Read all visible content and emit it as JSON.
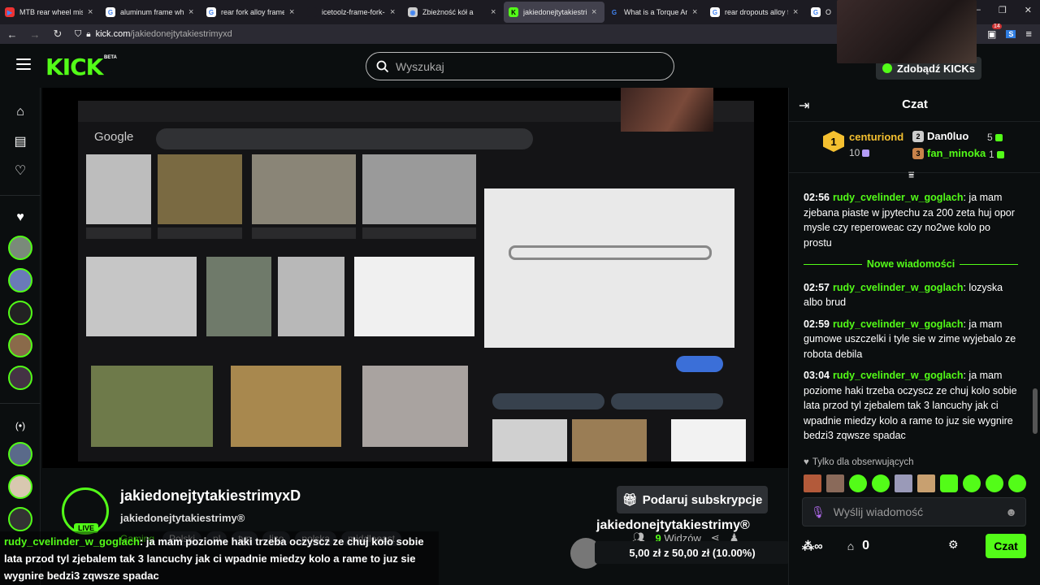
{
  "browser": {
    "tabs": [
      {
        "title": "MTB rear wheel mis",
        "fav_color": "#e33",
        "fav_glyph": "▶"
      },
      {
        "title": "aluminum frame wh",
        "fav_color": "#fff",
        "fav_glyph": "G"
      },
      {
        "title": "rear fork alloy frame",
        "fav_color": "#fff",
        "fav_glyph": "G"
      },
      {
        "title": "icetoolz-frame-fork-end",
        "fav_color": "#1c1b22",
        "fav_glyph": ""
      },
      {
        "title": "Zbieżność kół a",
        "fav_color": "#ccc",
        "fav_glyph": "◉"
      },
      {
        "title": "jakiedonejtytakiestri",
        "fav_color": "#53fc18",
        "fav_glyph": "K"
      },
      {
        "title": "What is a Torque Ar",
        "fav_color": "#1c1b22",
        "fav_glyph": "G"
      },
      {
        "title": "rear dropouts alloy f",
        "fav_color": "#fff",
        "fav_glyph": "G"
      },
      {
        "title": "O",
        "fav_color": "#fff",
        "fav_glyph": "G"
      }
    ],
    "url_domain": "kick.com",
    "url_path": "/jakiedonejtytakiestrimyxd",
    "ext_count": "14"
  },
  "header": {
    "logo": "KICK",
    "beta": "BETA",
    "search_placeholder": "Wyszukaj",
    "get_kicks": "Zdobądź KICKs"
  },
  "stream": {
    "title": "jakiedonejtytakiestrimyxD",
    "channel": "jakiedonejtytakiestrimy®",
    "live": "LIVE",
    "category": "Gaming",
    "tags": [
      "Polski",
      "pl",
      "tvp",
      "lizo",
      "polska",
      "middleeast"
    ],
    "gift_button": "Podaruj subskrypcje",
    "sub_name": "jakiedonejtytakiestrimy®",
    "viewers_count": "9",
    "viewers_label": "Widzów",
    "goal_text": "5,00 zł z 50,00 zł (10.00%)",
    "k_count": "9"
  },
  "overlay_message": {
    "user": "rudy_cvelinder_w_goglach",
    "text": "ja mam poziome haki trzeba oczyscz ze chuj kolo sobie lata przod tyl zjebalem tak 3 lancuchy jak ci wpadnie miedzy kolo a rame to juz sie wygnire bedzi3 zqwsze spadac"
  },
  "chat": {
    "title": "Czat",
    "leaderboard": [
      {
        "name": "centuriond",
        "count": "10",
        "rank": "1"
      },
      {
        "name": "Dan0luo",
        "count": "5",
        "rank": "2"
      },
      {
        "name": "fan_minoka",
        "count": "1",
        "rank": "3"
      }
    ],
    "new_messages_label": "Nowe wiadomości",
    "messages": [
      {
        "time": "02:56",
        "user": "rudy_cvelinder_w_goglach",
        "text": "ja mam zjebana piaste w jpytechu za 200 zeta huj opor mysle czy reperoweac czy no2we kolo po prostu"
      },
      {
        "time": "02:57",
        "user": "rudy_cvelinder_w_goglach",
        "text": "lozyska albo brud"
      },
      {
        "time": "02:59",
        "user": "rudy_cvelinder_w_goglach",
        "text": "ja mam gumowe uszczelki i tyle sie w zime wyjebalo ze robota debila"
      },
      {
        "time": "03:04",
        "user": "rudy_cvelinder_w_goglach",
        "text": "ja mam poziome haki trzeba oczyscz ze chuj kolo sobie lata przod tyl zjebalem tak 3 lancuchy jak ci wpadnie miedzy kolo a rame to juz sie wygnire bedzi3 zqwsze spadac"
      }
    ],
    "followers_only": "Tylko dla obserwujących",
    "input_placeholder": "Wyślij wiadomość",
    "points": "0",
    "send_button": "Czat",
    "infinity": "∞"
  },
  "colors": {
    "accent": "#53fc18",
    "bg": "#0b0e0f"
  }
}
